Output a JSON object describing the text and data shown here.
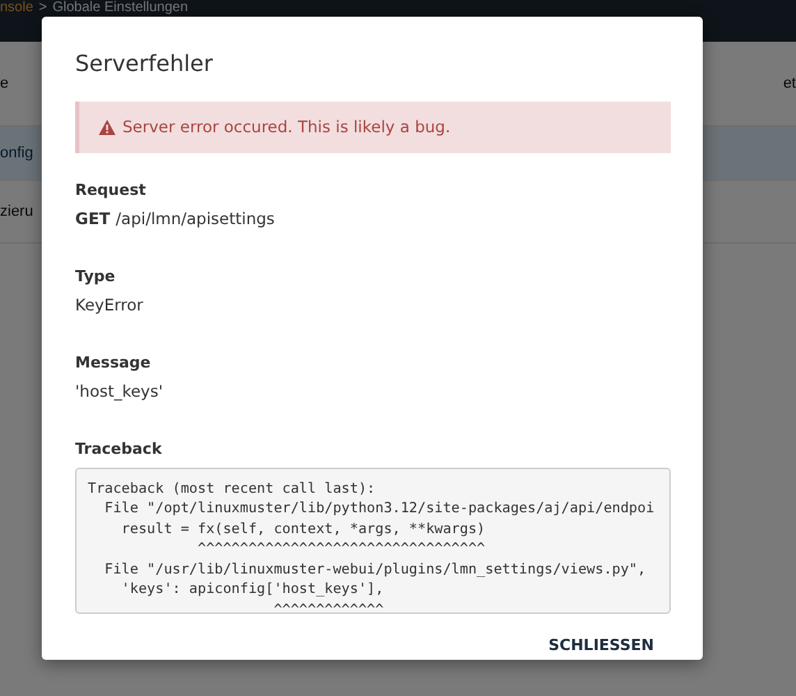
{
  "background": {
    "breadcrumb": [
      "nsole",
      ">",
      "Globale Einstellungen"
    ],
    "left_fragments": [
      "e",
      "onfig",
      "zieru"
    ],
    "right_fragments": [
      "et"
    ]
  },
  "dialog": {
    "title": "Serverfehler",
    "alert": {
      "kind": "danger",
      "text": "Server error occured. This is likely a bug."
    },
    "fields": [
      {
        "label": "Request",
        "method": "GET",
        "value": "/api/lmn/apisettings"
      },
      {
        "label": "Type",
        "value": "KeyError"
      },
      {
        "label": "Message",
        "value": "'host_keys'"
      }
    ],
    "traceback": {
      "label": "Traceback",
      "lines": [
        "Traceback (most recent call last):",
        "  File \"/opt/linuxmuster/lib/python3.12/site-packages/aj/api/endpoi",
        "    result = fx(self, context, *args, **kwargs)",
        "             ^^^^^^^^^^^^^^^^^^^^^^^^^^^^^^^^^^",
        "  File \"/usr/lib/linuxmuster-webui/plugins/lmn_settings/views.py\",",
        "    'keys': apiconfig['host_keys'],",
        "                      ^^^^^^^^^^^^^"
      ]
    },
    "buttons": [
      {
        "label": "SCHLIESSEN"
      }
    ]
  }
}
